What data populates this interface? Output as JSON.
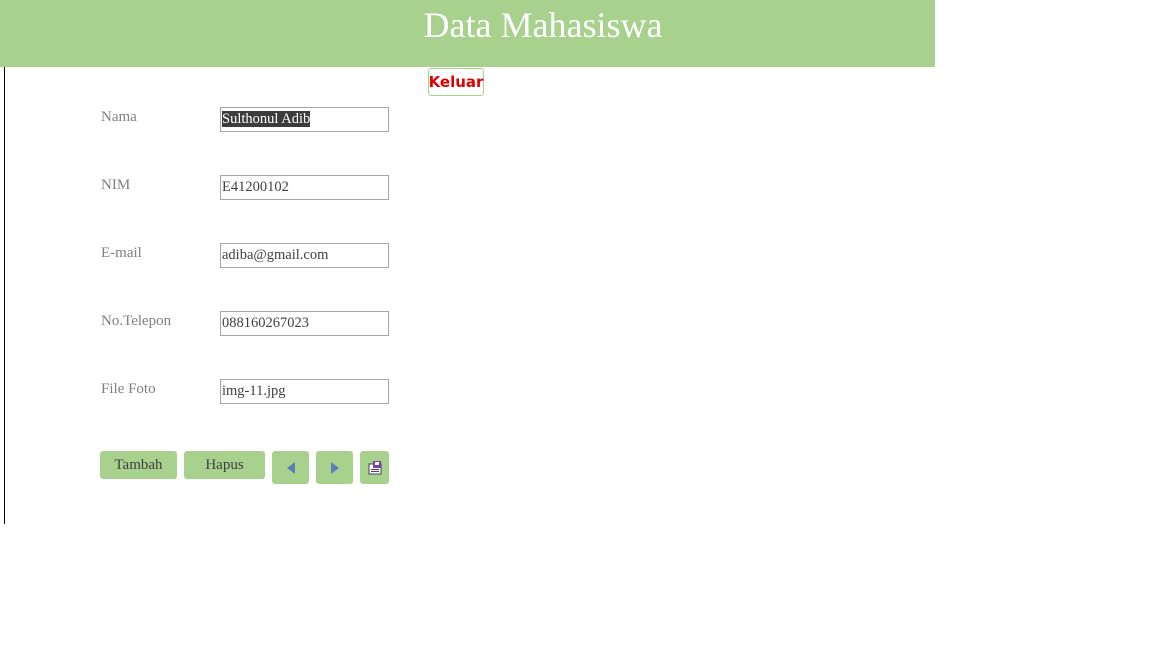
{
  "header": {
    "title": "Data Mahasiswa"
  },
  "exit_button": {
    "label": "Keluar"
  },
  "fields": [
    {
      "label": "Nama",
      "value": "Sulthonul Adib"
    },
    {
      "label": "NIM",
      "value": "E41200102"
    },
    {
      "label": "E-mail",
      "value": "adiba@gmail.com"
    },
    {
      "label": "No.Telepon",
      "value": "088160267023"
    },
    {
      "label": "File Foto",
      "value": "img-11.jpg"
    }
  ],
  "buttons": {
    "add": "Tambah",
    "delete": "Hapus",
    "prev_icon": "previous-record-icon",
    "next_icon": "next-record-icon",
    "save_icon": "save-record-icon"
  },
  "colors": {
    "accent": "#a9d18e",
    "exit_text": "#e00000",
    "nav_arrow": "#5b7fb6"
  }
}
